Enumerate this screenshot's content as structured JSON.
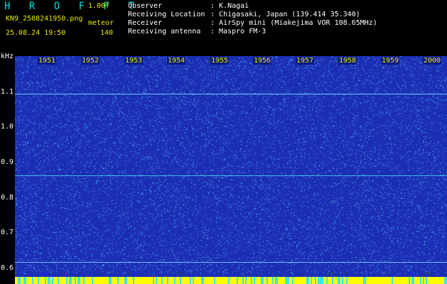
{
  "header": {
    "app_title": "H R O F F T",
    "version": "1.00f",
    "file_name": "KN9_2508241950.png",
    "mode": "meteor",
    "timestamp": "25.08.24 19:50",
    "count": "140"
  },
  "info": [
    {
      "label": "Observer",
      "value": "K.Nagai"
    },
    {
      "label": "Receiving Location",
      "value": "Chigasaki, Japan (139.414 35.340)"
    },
    {
      "label": "Receiver",
      "value": "AirSpy mini (Miakejima VOR 108.65MHz)"
    },
    {
      "label": "Receiving antenna",
      "value": "Maspro FM-3"
    }
  ],
  "spectrogram": {
    "y_unit": "kHz",
    "y_labels": [
      "1.1",
      "1.0",
      "0.9",
      "0.8",
      "0.7",
      "0.6"
    ],
    "x_labels": [
      "1951",
      "1952",
      "1953",
      "1954",
      "1955",
      "1956",
      "1957",
      "1958",
      "1959",
      "2000"
    ],
    "colors": {
      "background": "#1c2fb4",
      "noise_light": "#4fa0ff",
      "noise_cyan": "#3fe6e6",
      "signal": "#ffff00"
    }
  }
}
